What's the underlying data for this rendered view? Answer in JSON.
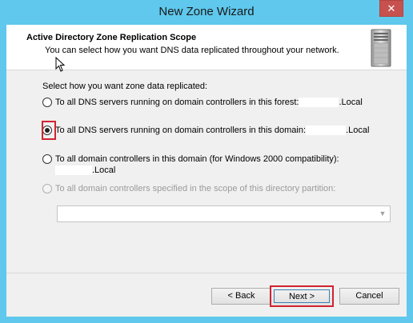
{
  "window": {
    "title": "New Zone Wizard",
    "close_glyph": "✕"
  },
  "header": {
    "title": "Active Directory Zone Replication Scope",
    "subtitle": "You can select how you want DNS data replicated throughout your network.",
    "icon": "server-icon"
  },
  "prompt": "Select how you want zone data replicated:",
  "options": [
    {
      "label": "To all DNS servers running on domain controllers in this forest:",
      "suffix": ".Local",
      "checked": false,
      "enabled": true
    },
    {
      "label": "To all DNS servers running on domain controllers in this domain:",
      "suffix": ".Local",
      "checked": true,
      "enabled": true
    },
    {
      "label": "To all domain controllers in this domain (for Windows 2000 compatibility):",
      "suffix": ".Local",
      "checked": false,
      "enabled": true
    },
    {
      "label": "To all domain controllers specified in the scope of this directory partition:",
      "checked": false,
      "enabled": false
    }
  ],
  "partition_select": {
    "value": "",
    "arrow": "▼"
  },
  "buttons": {
    "back": "< Back",
    "next": "Next >",
    "cancel": "Cancel"
  },
  "colors": {
    "title_bar": "#5fc8ec",
    "close_button": "#c7514f",
    "highlight_outline": "#d0242f"
  }
}
